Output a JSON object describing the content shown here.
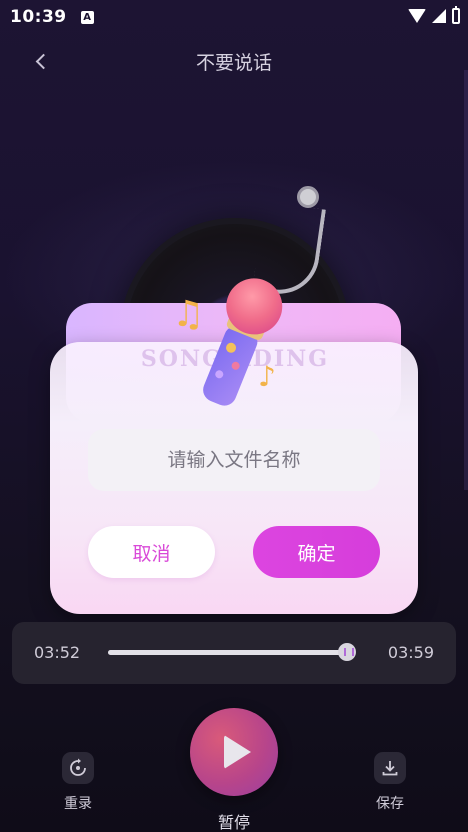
{
  "status_bar": {
    "time": "10:39",
    "notification_icon": "A"
  },
  "header": {
    "title": "不要说话"
  },
  "dialog": {
    "watermark": "SONG    RDING",
    "filename_placeholder": "请输入文件名称",
    "cancel_label": "取消",
    "confirm_label": "确定"
  },
  "player": {
    "elapsed": "03:52",
    "total": "03:59",
    "progress_fraction": 0.97
  },
  "controls": {
    "rerecord_label": "重录",
    "pause_label": "暂停",
    "save_label": "保存"
  },
  "colors": {
    "accent": "#d94ad8",
    "confirm_bg": "#dc45e0",
    "background": "#1a1230"
  },
  "icons": {
    "back": "back-arrow-icon",
    "rerecord": "rerecord-icon",
    "play": "play-icon",
    "save": "download-icon"
  }
}
